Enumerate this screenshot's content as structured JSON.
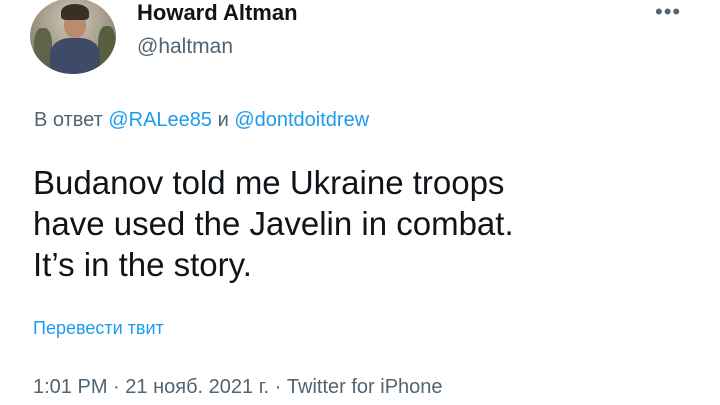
{
  "author": {
    "name": "Howard Altman",
    "handle": "@haltman",
    "avatar_icon": "profile-photo"
  },
  "more_icon": "ellipsis-icon",
  "more_label": "•••",
  "reply": {
    "prefix": "В ответ",
    "user1": "@RALee85",
    "conjunction": "и",
    "user2": "@dontdoitdrew"
  },
  "tweet": {
    "lines": [
      "Budanov told me Ukraine troops",
      "have used the Javelin in combat.",
      "It’s in the story."
    ]
  },
  "translate_label": "Перевести твит",
  "meta": {
    "time": "1:01 PM",
    "date": "21 нояб. 2021 г.",
    "source": "Twitter for iPhone",
    "separator": "·"
  },
  "colors": {
    "text": "#0f1419",
    "secondary": "#536471",
    "link": "#1d9bf0"
  }
}
